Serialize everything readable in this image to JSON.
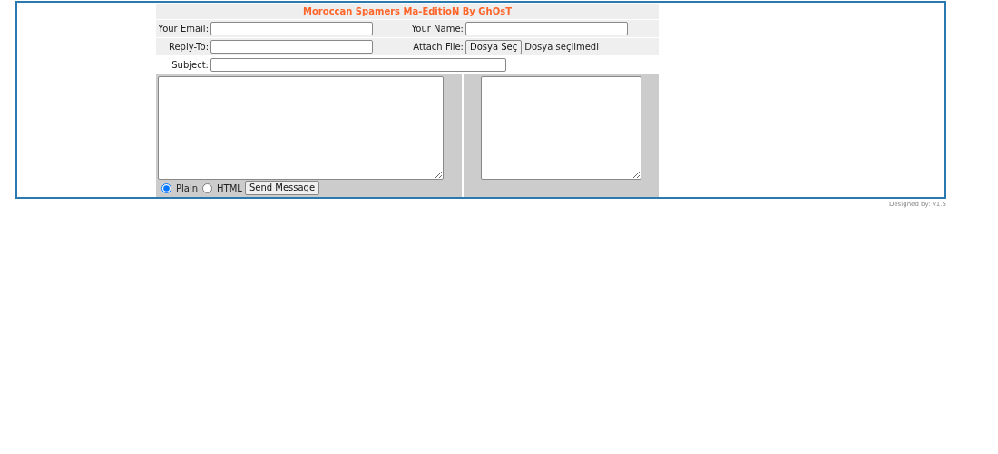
{
  "title": "Moroccan Spamers Ma-EditioN By GhOsT",
  "fields": [
    {
      "label": "Your Email:",
      "kind": "text"
    },
    {
      "label": "Your Name:",
      "kind": "text"
    },
    {
      "label": "Reply-To:",
      "kind": "text"
    },
    {
      "label": "Attach File:",
      "kind": "file",
      "button": "Dosya Seç",
      "status": "Dosya seçilmedi"
    },
    {
      "label": "Subject:",
      "kind": "text"
    }
  ],
  "format_options": [
    {
      "label": "Plain",
      "selected": true
    },
    {
      "label": "HTML",
      "selected": false
    }
  ],
  "send_button": "Send Message",
  "footer": "Designed by: v1.5"
}
